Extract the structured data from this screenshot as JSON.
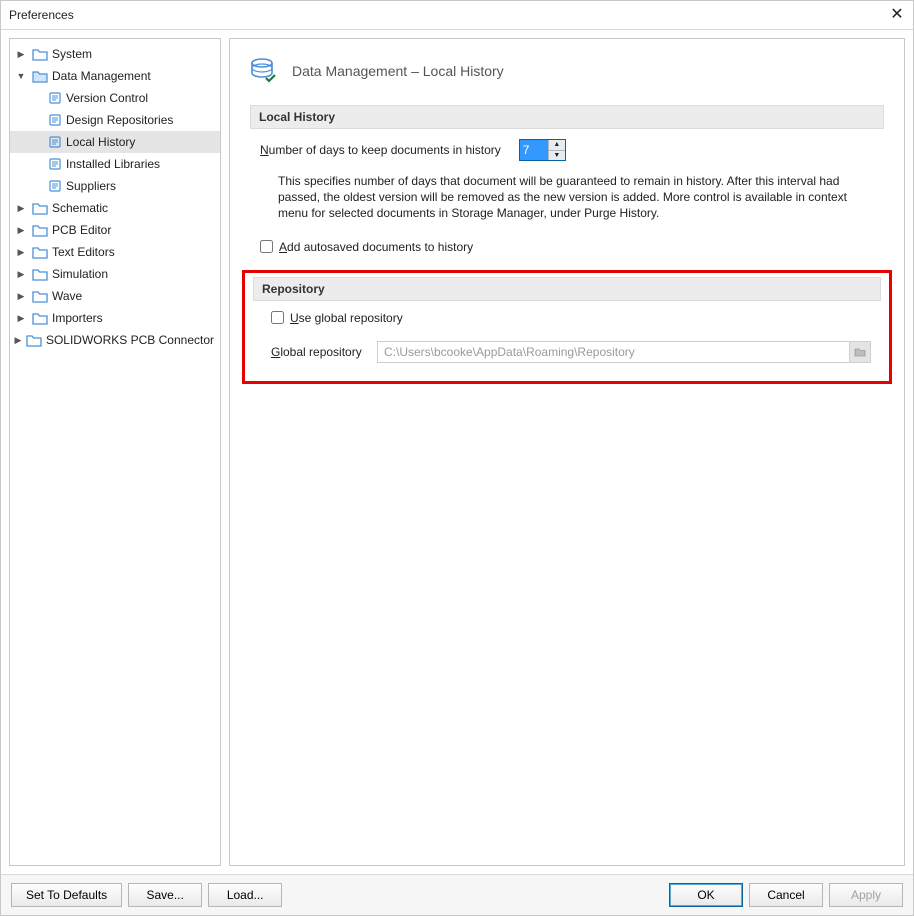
{
  "window_title": "Preferences",
  "tree": {
    "system": "System",
    "data_management": "Data Management",
    "version_control": "Version Control",
    "design_repositories": "Design Repositories",
    "local_history": "Local History",
    "installed_libraries": "Installed Libraries",
    "suppliers": "Suppliers",
    "schematic": "Schematic",
    "pcb_editor": "PCB Editor",
    "text_editors": "Text Editors",
    "simulation": "Simulation",
    "wave": "Wave",
    "importers": "Importers",
    "solidworks": "SOLIDWORKS PCB Connector"
  },
  "page_title": "Data Management – Local History",
  "local_history": {
    "section": "Local History",
    "days_label_pre": "N",
    "days_label_post": "umber of days to keep documents in history",
    "days_value": "7",
    "desc": "This specifies number of days that document will be guaranteed to remain in history. After this interval had passed, the oldest version will be removed as the new version is added. More control is available in context menu for selected documents in Storage Manager, under Purge History.",
    "autosave_pre": "A",
    "autosave_post": "dd autosaved documents to history"
  },
  "repository": {
    "section": "Repository",
    "use_global_pre": "U",
    "use_global_post": "se global repository",
    "global_label_pre": "G",
    "global_label_post": "lobal repository",
    "path": "C:\\Users\\bcooke\\AppData\\Roaming\\Repository"
  },
  "footer": {
    "defaults": "Set To Defaults",
    "save": "Save...",
    "load": "Load...",
    "ok": "OK",
    "cancel": "Cancel",
    "apply": "Apply"
  }
}
